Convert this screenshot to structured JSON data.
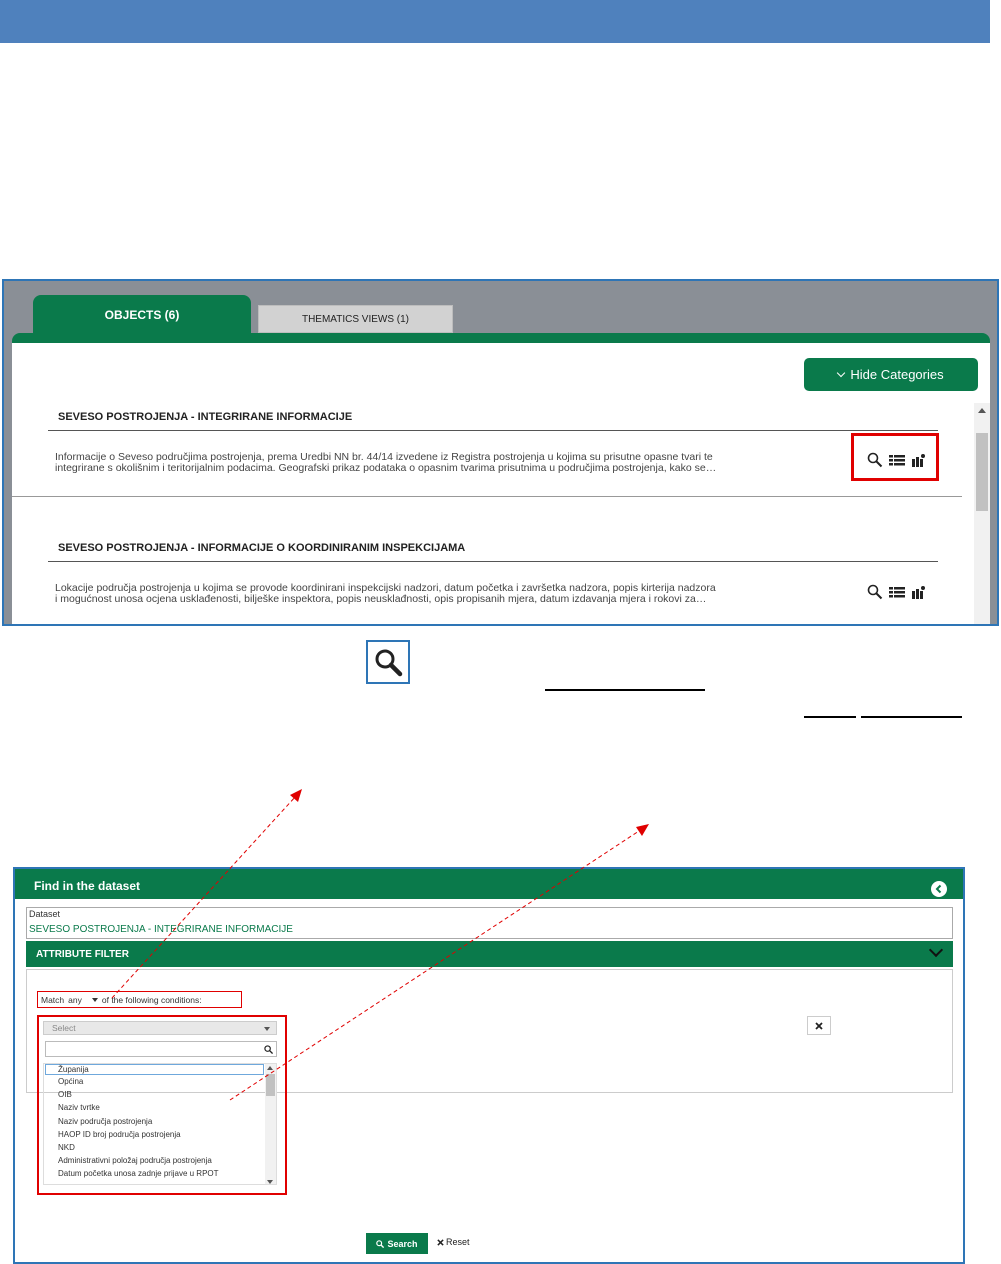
{
  "colors": {
    "brand_green": "#0a7a4b",
    "header_blue": "#4f81bd",
    "frame_blue": "#2e75b6",
    "annotation_red": "#e00000"
  },
  "objects_panel": {
    "tabs": [
      {
        "label": "OBJECTS (6)",
        "active": true
      },
      {
        "label": "THEMATICS VIEWS (1)",
        "active": false
      }
    ],
    "hide_categories_label": "Hide Categories",
    "items": [
      {
        "title": "SEVESO POSTROJENJA - INTEGRIRANE INFORMACIJE",
        "description_line1": "Informacije o Seveso područjima postrojenja, prema Uredbi NN br. 44/14 izvedene iz Registra postrojenja u kojima su prisutne opasne tvari te",
        "description_line2": "integrirane s okolišnim i teritorijalnim podacima. Geografski prikaz podataka o opasnim tvarima prisutnima u područjima postrojenja, kako se…",
        "icons": [
          "search-icon",
          "table-icon",
          "map-icon"
        ]
      },
      {
        "title": "SEVESO POSTROJENJA - INFORMACIJE O KOORDINIRANIM INSPEKCIJAMA",
        "description_line1": "Lokacije područja postrojenja u kojima se provode koordinirani inspekcijski nadzori, datum početka i završetka nadzora, popis kirterija nadzora",
        "description_line2": "i mogućnost unosa ocjena usklađenosti, bilješke inspektora, popis neusklađnosti, opis propisanih mjera, datum izdavanja mjera i rokovi za…",
        "icons": [
          "search-icon",
          "table-icon",
          "map-icon"
        ]
      }
    ]
  },
  "find_panel": {
    "header_title": "Find in the dataset",
    "dataset_label": "Dataset",
    "dataset_value": "SEVESO POSTROJENJA - INTEGRIRANE INFORMACIJE",
    "attribute_filter_title": "ATTRIBUTE FILTER",
    "match_prefix": "Match",
    "match_value": "any",
    "match_suffix": "of the following conditions:",
    "select_placeholder": "Select",
    "options": [
      "Županija",
      "Općina",
      "OIB",
      "Naziv tvrtke",
      "Naziv područja postrojenja",
      "HAOP ID broj područja postrojenja",
      "NKD",
      "Administrativni položaj područja postrojenja",
      "Datum početka unosa zadnje prijave u RPOT"
    ],
    "search_label": "Search",
    "reset_label": "Reset"
  }
}
